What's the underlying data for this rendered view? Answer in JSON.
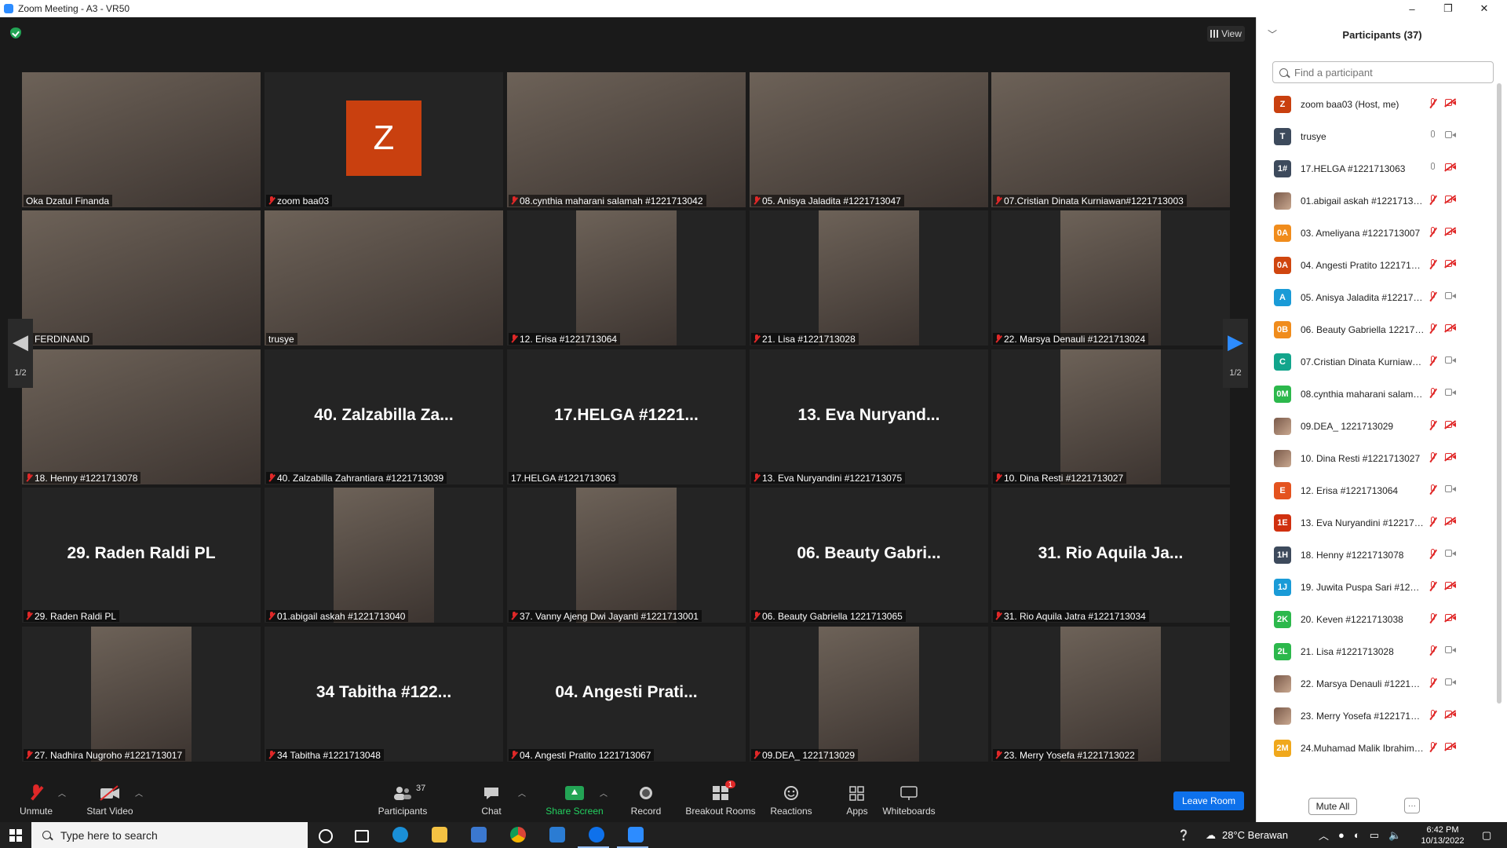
{
  "window": {
    "title": "Zoom Meeting - A3 - VR50",
    "minimize": "–",
    "maximize": "❐",
    "close": "✕"
  },
  "view_button": {
    "label": "View"
  },
  "tiles": [
    {
      "name": "Oka Dzatul Finanda",
      "muted": false,
      "kind": "video"
    },
    {
      "name": "zoom baa03",
      "muted": true,
      "kind": "avatar",
      "avatar_letter": "Z"
    },
    {
      "name": "08.cynthia maharani salamah #1221713042",
      "muted": true,
      "kind": "video"
    },
    {
      "name": "05. Anisya Jaladita #1221713047",
      "muted": true,
      "kind": "video"
    },
    {
      "name": "07.Cristian Dinata Kurniawan#1221713003",
      "muted": true,
      "kind": "video"
    },
    {
      "name": "FERDINAND",
      "muted": true,
      "kind": "video"
    },
    {
      "name": "trusye",
      "muted": false,
      "kind": "video",
      "active": true
    },
    {
      "name": "12. Erisa #1221713064",
      "muted": true,
      "kind": "video"
    },
    {
      "name": "21. Lisa #1221713028",
      "muted": true,
      "kind": "video"
    },
    {
      "name": "22. Marsya Denauli #1221713024",
      "muted": true,
      "kind": "video"
    },
    {
      "name": "18. Henny #1221713078",
      "muted": true,
      "kind": "video"
    },
    {
      "name": "40. Zalzabilla Zahrantiara #1221713039",
      "muted": true,
      "kind": "name",
      "display": "40. Zalzabilla Za..."
    },
    {
      "name": "17.HELGA #1221713063",
      "muted": false,
      "kind": "name",
      "display": "17.HELGA #1221..."
    },
    {
      "name": "13. Eva Nuryandini #1221713075",
      "muted": true,
      "kind": "name",
      "display": "13. Eva Nuryand..."
    },
    {
      "name": "10. Dina Resti #1221713027",
      "muted": true,
      "kind": "video"
    },
    {
      "name": "29. Raden Raldi PL",
      "muted": true,
      "kind": "name",
      "display": "29. Raden Raldi PL"
    },
    {
      "name": "01.abigail askah #1221713040",
      "muted": true,
      "kind": "video"
    },
    {
      "name": "37. Vanny Ajeng Dwi Jayanti #1221713001",
      "muted": true,
      "kind": "video"
    },
    {
      "name": "06. Beauty Gabriella 1221713065",
      "muted": true,
      "kind": "name",
      "display": "06. Beauty Gabri..."
    },
    {
      "name": "31. Rio Aquila Jatra #1221713034",
      "muted": true,
      "kind": "name",
      "display": "31. Rio Aquila Ja..."
    },
    {
      "name": "27. Nadhira Nugroho #1221713017",
      "muted": true,
      "kind": "video"
    },
    {
      "name": "34 Tabitha #1221713048",
      "muted": true,
      "kind": "name",
      "display": "34 Tabitha #122..."
    },
    {
      "name": "04. Angesti Pratito 1221713067",
      "muted": true,
      "kind": "name",
      "display": "04. Angesti Prati..."
    },
    {
      "name": "09.DEA_ 1221713029",
      "muted": true,
      "kind": "video"
    },
    {
      "name": "23. Merry Yosefa #1221713022",
      "muted": true,
      "kind": "video"
    }
  ],
  "paging": {
    "left_label": "1/2",
    "right_label": "1/2"
  },
  "toolbar": {
    "unmute": "Unmute",
    "start_video": "Start Video",
    "participants": "Participants",
    "participants_count": "37",
    "chat": "Chat",
    "share_screen": "Share Screen",
    "record": "Record",
    "breakout_rooms": "Breakout Rooms",
    "breakout_badge": "1",
    "reactions": "Reactions",
    "apps": "Apps",
    "whiteboards": "Whiteboards",
    "leave": "Leave Room"
  },
  "panel": {
    "title": "Participants (37)",
    "search_placeholder": "Find a participant",
    "mute_all": "Mute All",
    "more": "···",
    "participants": [
      {
        "initials": "Z",
        "color": "#c9400f",
        "name": "zoom baa03 (Host, me)",
        "mic": "off",
        "cam": "off"
      },
      {
        "initials": "T",
        "color": "#3d4a5c",
        "name": "trusye",
        "mic": "on",
        "cam": "on"
      },
      {
        "initials": "1#",
        "color": "#3d4a5c",
        "name": "17.HELGA #1221713063",
        "mic": "on",
        "cam": "off"
      },
      {
        "initials": "",
        "color": "photo",
        "name": "01.abigail askah #1221713040",
        "mic": "off",
        "cam": "off"
      },
      {
        "initials": "0A",
        "color": "#f08c1c",
        "name": "03. Ameliyana #1221713007",
        "mic": "off",
        "cam": "off"
      },
      {
        "initials": "0A",
        "color": "#d0460f",
        "name": "04. Angesti Pratito 1221713067",
        "mic": "off",
        "cam": "off"
      },
      {
        "initials": "A",
        "color": "#1a9bd7",
        "name": "05. Anisya Jaladita #1221713047",
        "mic": "off",
        "cam": "on"
      },
      {
        "initials": "0B",
        "color": "#f08c1c",
        "name": "06. Beauty Gabriella 1221713065",
        "mic": "off",
        "cam": "off"
      },
      {
        "initials": "C",
        "color": "#12a58c",
        "name": "07.Cristian Dinata Kurniawan#1221713003",
        "mic": "off",
        "cam": "on"
      },
      {
        "initials": "0M",
        "color": "#2cb84c",
        "name": "08.cynthia maharani salamah #1221713042",
        "mic": "off",
        "cam": "on"
      },
      {
        "initials": "",
        "color": "photo",
        "name": "09.DEA_ 1221713029",
        "mic": "off",
        "cam": "off"
      },
      {
        "initials": "",
        "color": "photo",
        "name": "10. Dina Resti #1221713027",
        "mic": "off",
        "cam": "off"
      },
      {
        "initials": "E",
        "color": "#e4531f",
        "name": "12. Erisa #1221713064",
        "mic": "off",
        "cam": "on"
      },
      {
        "initials": "1E",
        "color": "#d0300f",
        "name": "13. Eva Nuryandini #1221713075",
        "mic": "off",
        "cam": "off"
      },
      {
        "initials": "1H",
        "color": "#3d4a5c",
        "name": "18. Henny #1221713078",
        "mic": "off",
        "cam": "on"
      },
      {
        "initials": "1J",
        "color": "#1a9bd7",
        "name": "19. Juwita Puspa Sari #1221713...",
        "mic": "off",
        "cam": "off"
      },
      {
        "initials": "2K",
        "color": "#2cb84c",
        "name": "20. Keven #1221713038",
        "mic": "off",
        "cam": "off"
      },
      {
        "initials": "2L",
        "color": "#2cb84c",
        "name": "21. Lisa #1221713028",
        "mic": "off",
        "cam": "on"
      },
      {
        "initials": "",
        "color": "photo",
        "name": "22. Marsya Denauli #12217130...",
        "mic": "off",
        "cam": "on"
      },
      {
        "initials": "",
        "color": "photo",
        "name": "23. Merry Yosefa #1221713022",
        "mic": "off",
        "cam": "off"
      },
      {
        "initials": "2M",
        "color": "#f0a81c",
        "name": "24.Muhamad Malik Ibrahim - 1...",
        "mic": "off",
        "cam": "off"
      }
    ]
  },
  "taskbar": {
    "search_placeholder": "Type here to search",
    "weather": "28°C Berawan",
    "time": "6:42 PM",
    "date": "10/13/2022"
  }
}
